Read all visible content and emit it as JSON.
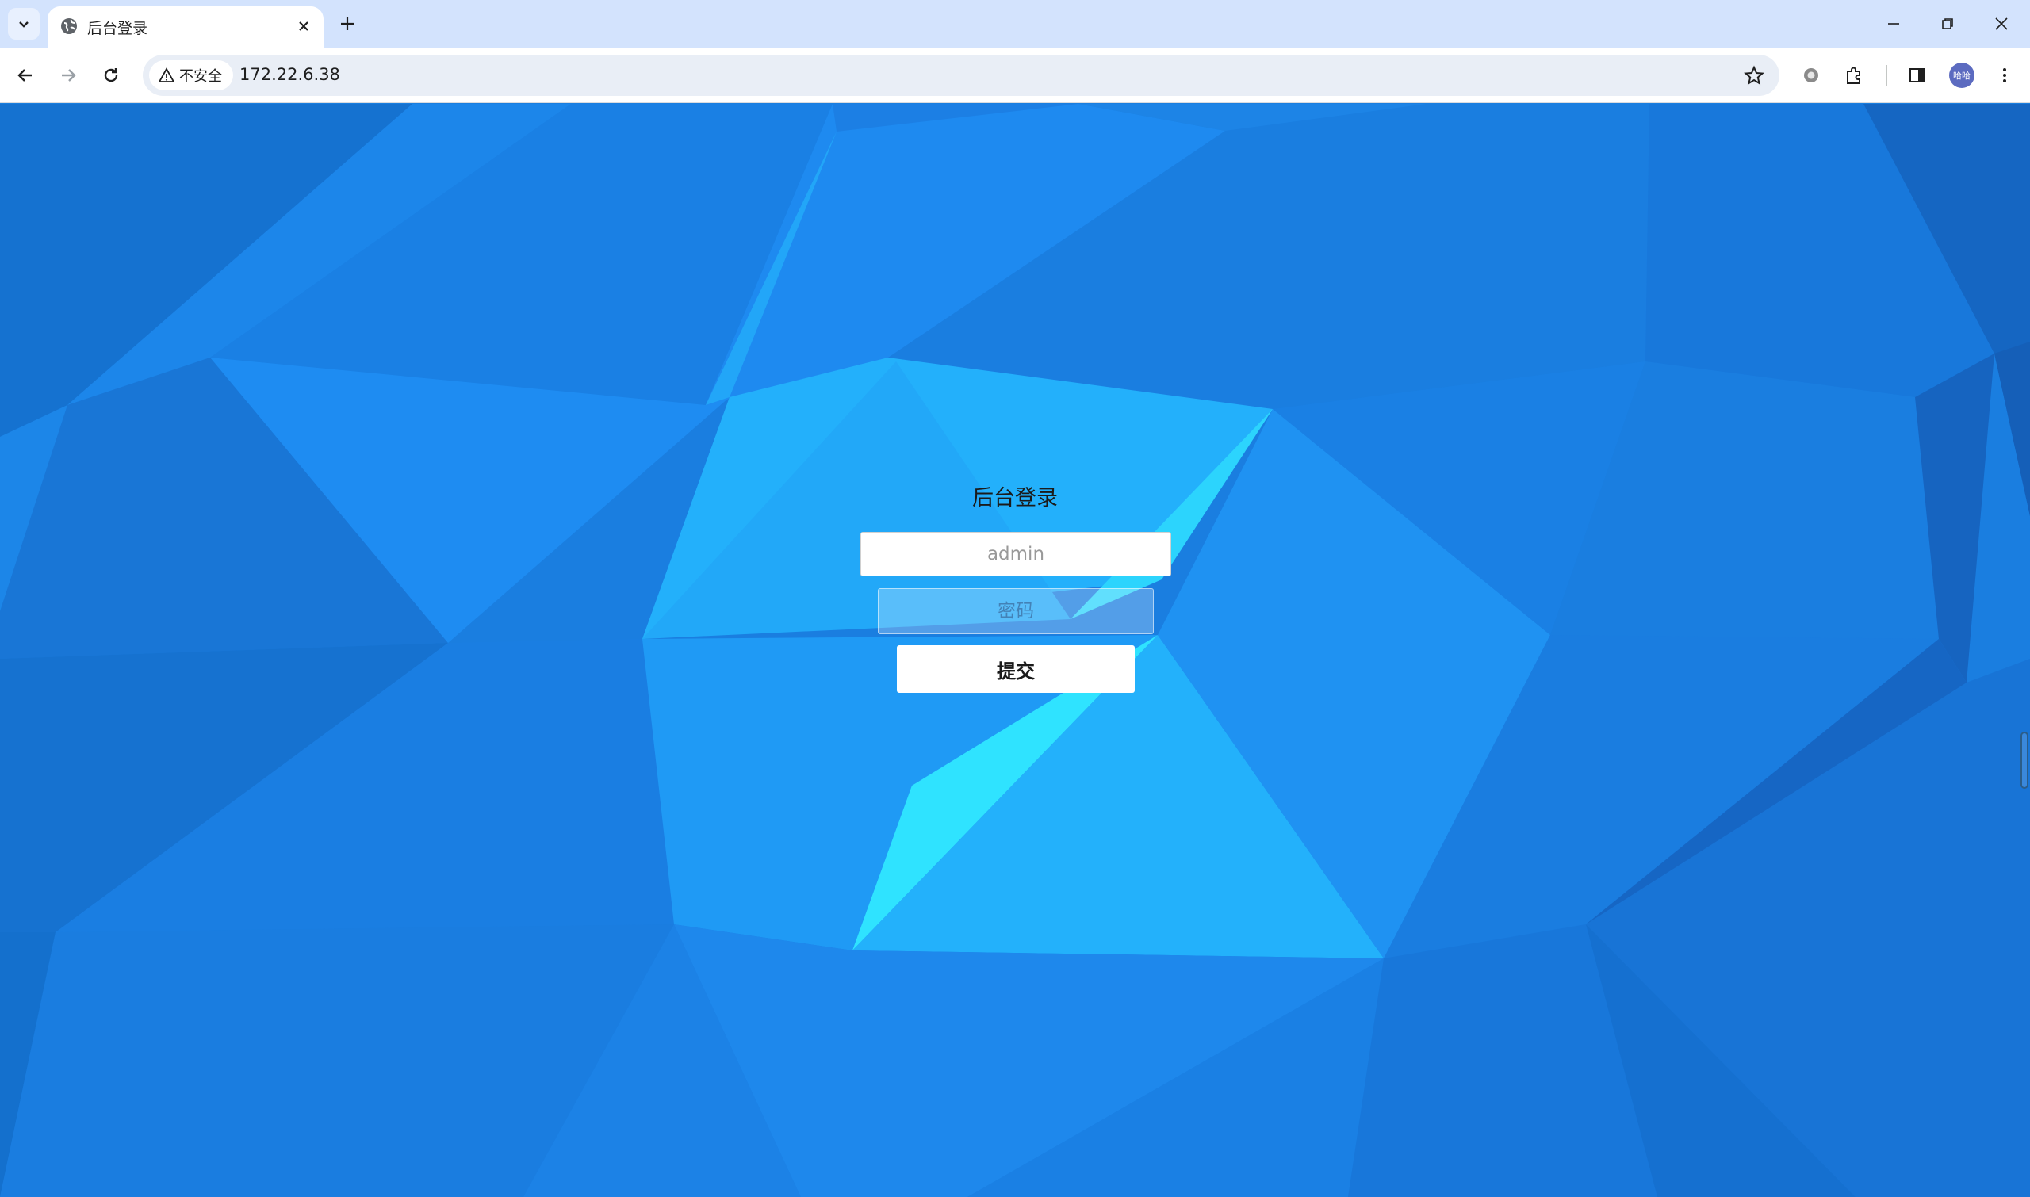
{
  "browser": {
    "tab_title": "后台登录",
    "security_label": "不安全",
    "url": "172.22.6.38",
    "profile_initials": "哈哈"
  },
  "page": {
    "title": "后台登录",
    "username_value": "",
    "username_placeholder": "admin",
    "password_placeholder": "密码",
    "submit_label": "提交"
  }
}
